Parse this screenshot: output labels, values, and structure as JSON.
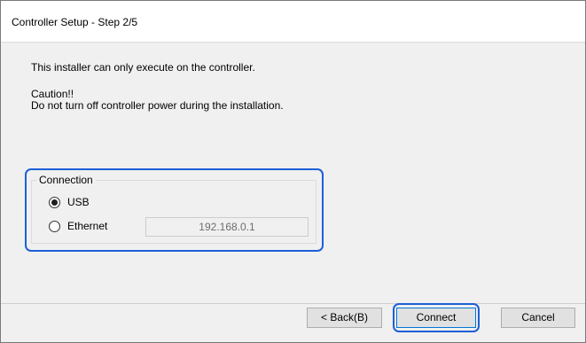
{
  "window": {
    "title": "Controller Setup - Step 2/5"
  },
  "messages": {
    "line1": "This installer can only execute on the controller.",
    "line2": "Caution!!",
    "line3": "Do not turn off controller power during the installation."
  },
  "connection": {
    "legend": "Connection",
    "options": [
      {
        "label": "USB",
        "selected": true
      },
      {
        "label": "Ethernet",
        "selected": false
      }
    ],
    "ip_address": "192.168.0.1"
  },
  "buttons": {
    "back": "< Back(B)",
    "connect": "Connect",
    "cancel": "Cancel"
  },
  "colors": {
    "highlight": "#1e5fd6",
    "window_bg": "#f0f0f0"
  }
}
